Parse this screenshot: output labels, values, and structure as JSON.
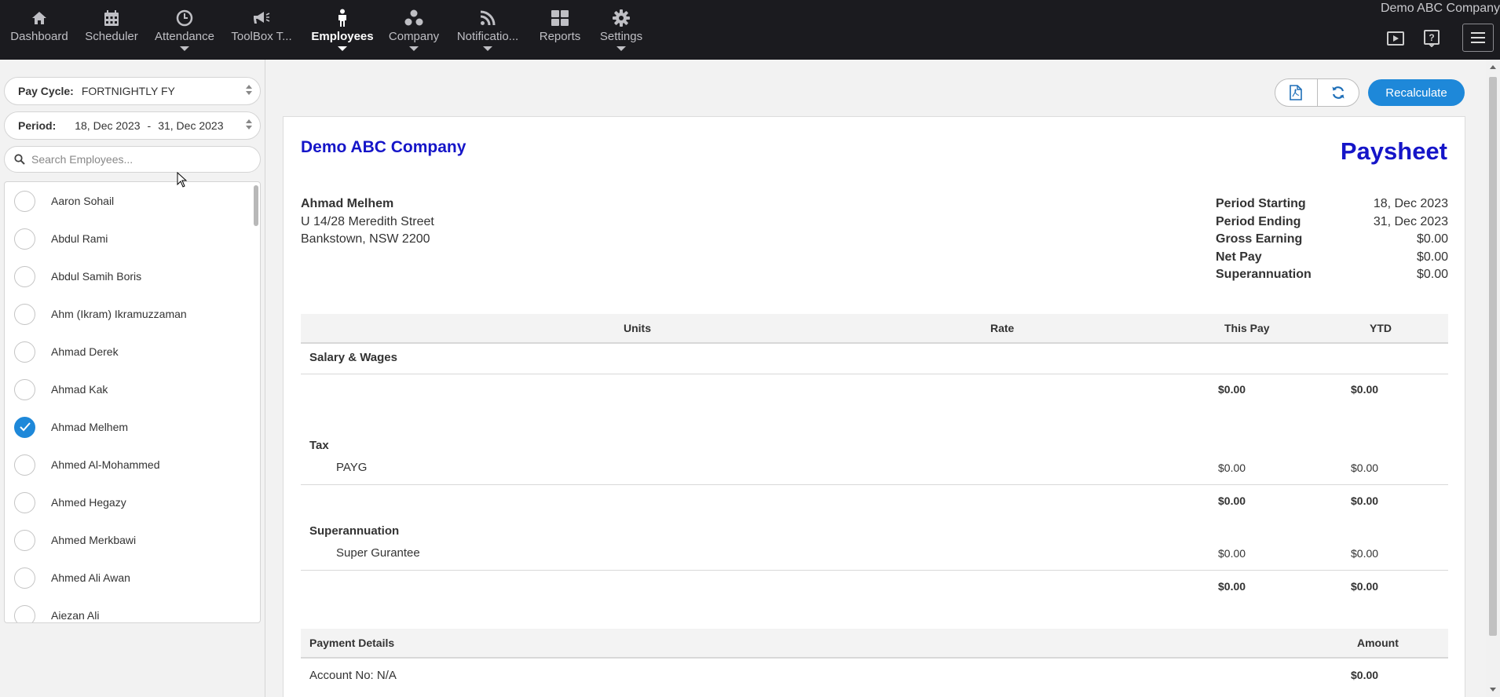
{
  "nav": {
    "items": [
      {
        "label": "Dashboard",
        "icon": "home-icon",
        "active": false
      },
      {
        "label": "Scheduler",
        "icon": "calendar-icon",
        "active": false
      },
      {
        "label": "Attendance",
        "icon": "clock-icon",
        "active": false
      },
      {
        "label": "ToolBox T...",
        "icon": "megaphone-icon",
        "active": false
      },
      {
        "label": "Employees",
        "icon": "person-icon",
        "active": true
      },
      {
        "label": "Company",
        "icon": "group-icon",
        "active": false
      },
      {
        "label": "Notificatio...",
        "icon": "rss-icon",
        "active": false
      },
      {
        "label": "Reports",
        "icon": "grid-icon",
        "active": false
      },
      {
        "label": "Settings",
        "icon": "gear-icon",
        "active": false
      }
    ],
    "brand": "Demo ABC Company"
  },
  "sidebar": {
    "pay_cycle_label": "Pay Cycle:",
    "pay_cycle_value": "FORTNIGHTLY FY",
    "period_label": "Period:",
    "period_start": "18, Dec 2023",
    "period_sep": "-",
    "period_end": "31, Dec 2023",
    "search_placeholder": "Search Employees...",
    "employees": [
      {
        "name": "Aaron Sohail",
        "checked": false
      },
      {
        "name": "Abdul Rami",
        "checked": false
      },
      {
        "name": "Abdul Samih Boris",
        "checked": false
      },
      {
        "name": "Ahm (Ikram) Ikramuzzaman",
        "checked": false
      },
      {
        "name": "Ahmad Derek",
        "checked": false
      },
      {
        "name": "Ahmad Kak",
        "checked": false
      },
      {
        "name": "Ahmad Melhem",
        "checked": true
      },
      {
        "name": "Ahmed Al-Mohammed",
        "checked": false
      },
      {
        "name": "Ahmed Hegazy",
        "checked": false
      },
      {
        "name": "Ahmed Merkbawi",
        "checked": false
      },
      {
        "name": "Ahmed Ali Awan",
        "checked": false
      },
      {
        "name": "Aiezan Ali",
        "checked": false
      }
    ]
  },
  "toolbar": {
    "recalculate_label": "Recalculate",
    "accent": "#1e88d9"
  },
  "paysheet": {
    "company": "Demo ABC Company",
    "title": "Paysheet",
    "title_color": "#1515c8",
    "employee_name": "Ahmad Melhem",
    "address_line1": "U 14/28 Meredith Street",
    "address_line2": "Bankstown, NSW 2200",
    "summary": [
      {
        "label": "Period Starting",
        "value": "18, Dec 2023"
      },
      {
        "label": "Period Ending",
        "value": "31, Dec 2023"
      },
      {
        "label": "Gross Earning",
        "value": "$0.00"
      },
      {
        "label": "Net Pay",
        "value": "$0.00"
      },
      {
        "label": "Superannuation",
        "value": "$0.00"
      }
    ],
    "columns": {
      "units": "Units",
      "rate": "Rate",
      "this_pay": "This Pay",
      "ytd": "YTD"
    },
    "salary": {
      "title": "Salary & Wages",
      "total_this_pay": "$0.00",
      "total_ytd": "$0.00"
    },
    "tax": {
      "title": "Tax",
      "line_label": "PAYG",
      "line_this_pay": "$0.00",
      "line_ytd": "$0.00",
      "total_this_pay": "$0.00",
      "total_ytd": "$0.00"
    },
    "super": {
      "title": "Superannuation",
      "line_label": "Super Gurantee",
      "line_this_pay": "$0.00",
      "line_ytd": "$0.00",
      "total_this_pay": "$0.00",
      "total_ytd": "$0.00"
    },
    "payment": {
      "title": "Payment Details",
      "amount_header": "Amount",
      "account": "Account No: N/A",
      "amount": "$0.00"
    }
  }
}
